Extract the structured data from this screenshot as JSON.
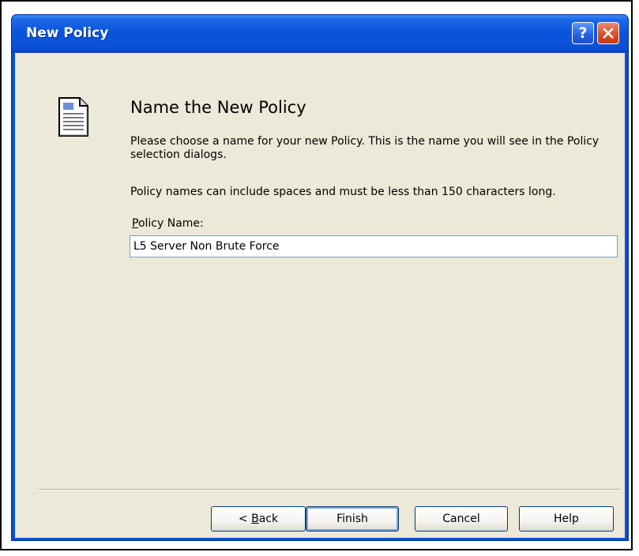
{
  "window": {
    "title": "New Policy",
    "help_glyph": "?",
    "close_icon": "close-icon"
  },
  "content": {
    "heading": "Name the New Policy",
    "description_1": "Please choose a name for your new Policy.  This is the name you will see in the Policy selection dialogs.",
    "description_2": "Policy names can include spaces and must be less than 150 characters long.",
    "icon": "document-icon"
  },
  "field": {
    "label_mnemonic": "P",
    "label_rest": "olicy Name:",
    "value": "L5 Server Non Brute Force"
  },
  "buttons": {
    "back_prefix": "< ",
    "back_mnemonic": "B",
    "back_rest": "ack",
    "finish": "Finish",
    "cancel": "Cancel",
    "help": "Help"
  },
  "colors": {
    "titlebar": "#0a55dd",
    "dialog_background": "#ece9d8",
    "close_button": "#d94d26",
    "help_button": "#2461e3"
  }
}
